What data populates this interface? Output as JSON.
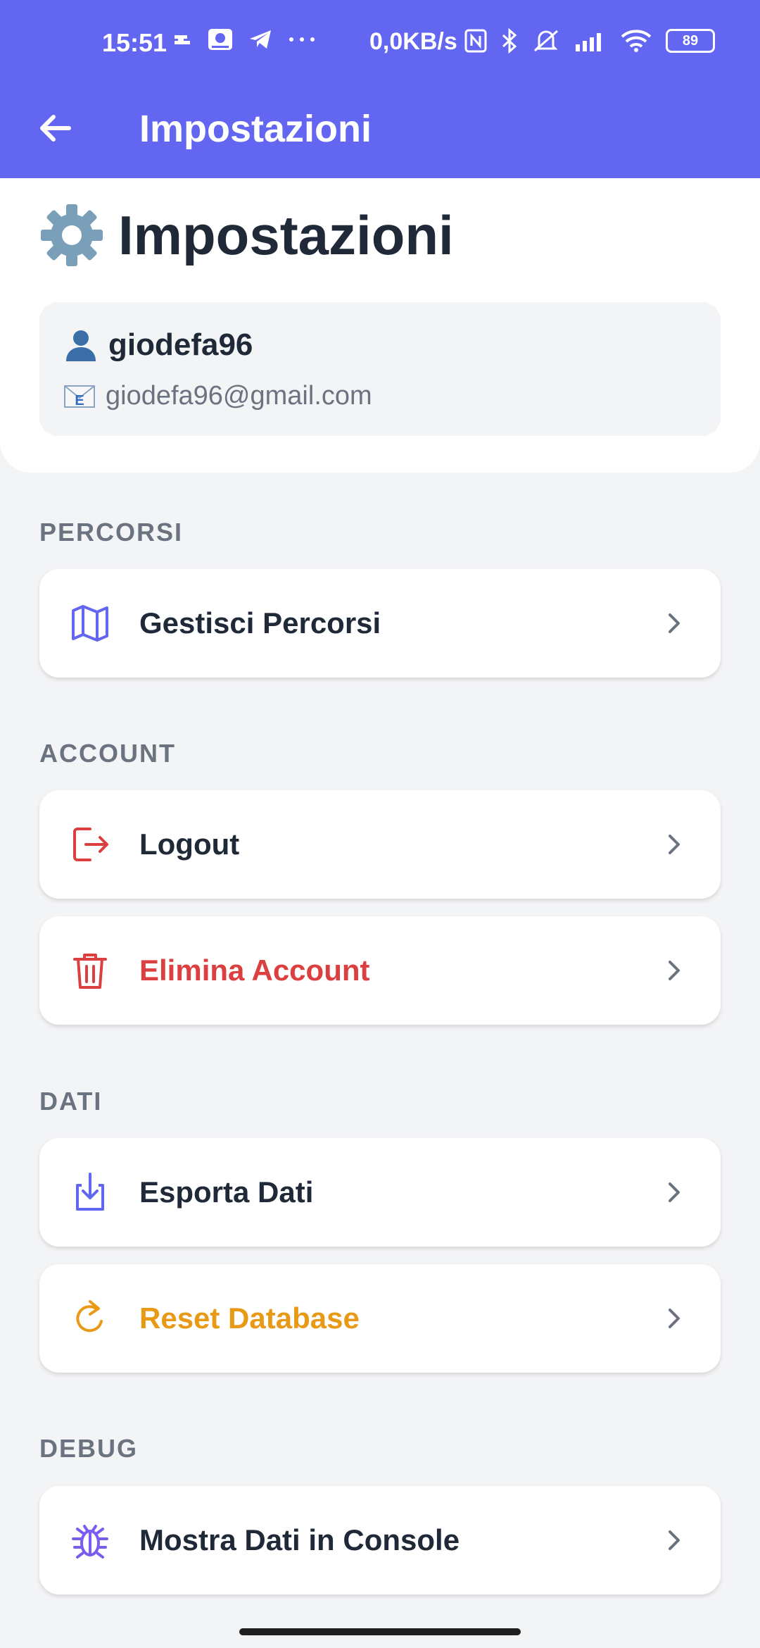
{
  "status_bar": {
    "time": "15:51",
    "network_speed": "0,0KB/s",
    "battery_level": "89",
    "icons": [
      "sync-icon",
      "camera-icon",
      "telegram-icon",
      "more-dots-icon",
      "nfc-icon",
      "bluetooth-icon",
      "mute-icon",
      "signal-icon",
      "wifi-icon",
      "battery-icon"
    ]
  },
  "app_bar": {
    "title": "Impostazioni",
    "back_icon": "arrow-left-icon"
  },
  "header": {
    "emoji": "⚙️",
    "title": "Impostazioni",
    "user_emoji": "👤",
    "username": "giodefa96",
    "email_emoji": "📧",
    "email": "giodefa96@gmail.com"
  },
  "sections": {
    "percorsi": {
      "label": "PERCORSI",
      "items": [
        {
          "label": "Gestisci Percorsi",
          "icon": "map-icon",
          "color": "#1f2937"
        }
      ]
    },
    "account": {
      "label": "ACCOUNT",
      "items": [
        {
          "label": "Logout",
          "icon": "logout-icon",
          "color": "#1f2937"
        },
        {
          "label": "Elimina Account",
          "icon": "trash-icon",
          "color": "#dc3f3f"
        }
      ]
    },
    "dati": {
      "label": "DATI",
      "items": [
        {
          "label": "Esporta Dati",
          "icon": "download-icon",
          "color": "#1f2937"
        },
        {
          "label": "Reset Database",
          "icon": "refresh-icon",
          "color": "#e89a16"
        }
      ]
    },
    "debug": {
      "label": "DEBUG",
      "items": [
        {
          "label": "Mostra Dati in Console",
          "icon": "bug-icon",
          "color": "#1f2937"
        }
      ]
    }
  },
  "colors": {
    "accent": "#6366f1",
    "danger": "#dc3f3f",
    "warning": "#e89a16",
    "text": "#1f2937",
    "muted": "#6b7280"
  }
}
